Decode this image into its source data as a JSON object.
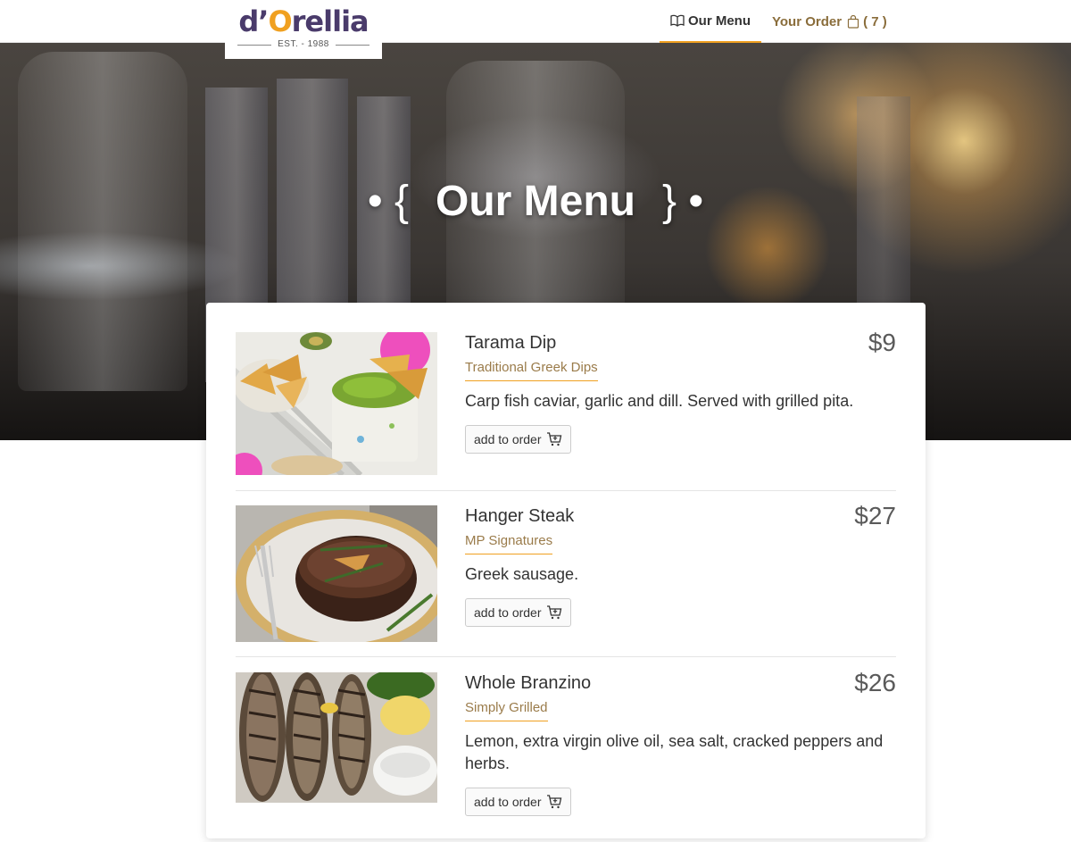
{
  "brand": {
    "name_part1": "d’",
    "name_o": "O",
    "name_part2": "rellia",
    "established": "EST. - 1988"
  },
  "nav": {
    "menu_label": "Our Menu",
    "order_label": "Your Order",
    "order_count": "( 7 )"
  },
  "hero": {
    "title": "Our Menu",
    "left_ornament": "• {",
    "right_ornament": "} •"
  },
  "menu": {
    "add_label": "add to order",
    "items": [
      {
        "name": "Tarama Dip",
        "category": "Traditional Greek Dips",
        "description": "Carp fish caviar, garlic and dill. Served with grilled pita.",
        "price": "$9",
        "image": "dip-photo"
      },
      {
        "name": "Hanger Steak",
        "category": "MP Signatures",
        "description": "Greek sausage.",
        "price": "$27",
        "image": "steak-photo"
      },
      {
        "name": "Whole Branzino",
        "category": "Simply Grilled",
        "description": "Lemon, extra virgin olive oil, sea salt, cracked peppers and herbs.",
        "price": "$26",
        "image": "fish-photo"
      }
    ]
  },
  "colors": {
    "accent": "#f0a020",
    "brand_purple": "#4a3b6b",
    "category_text": "#9a7b4a"
  }
}
